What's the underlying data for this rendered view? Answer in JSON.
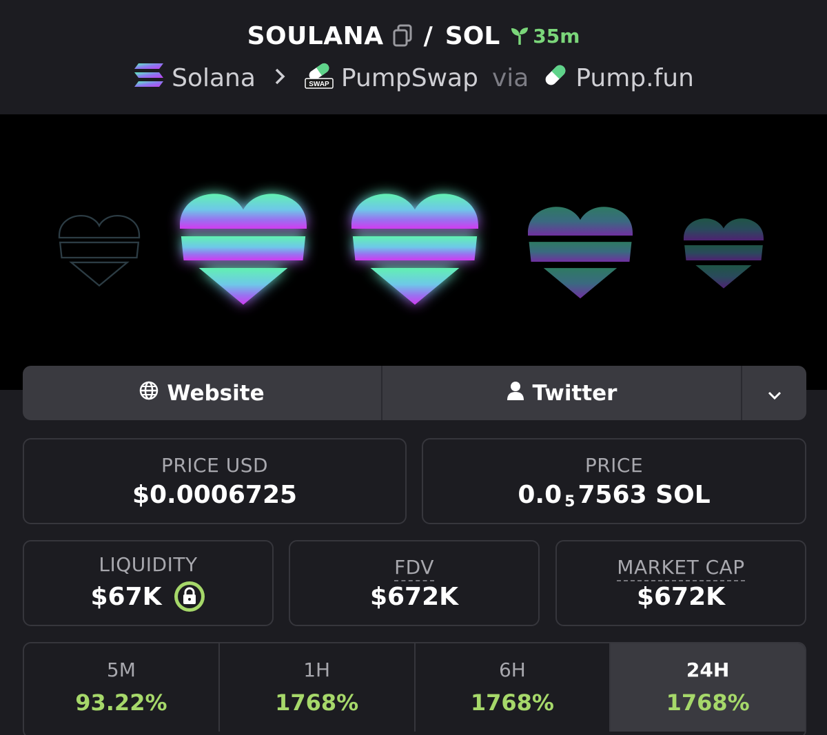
{
  "header": {
    "base_symbol": "SOULANA",
    "separator": "/",
    "quote_symbol": "SOL",
    "age": "35m",
    "chain": "Solana",
    "dex": "PumpSwap",
    "via_label": "via",
    "launchpad": "Pump.fun",
    "icons": {
      "copy": "copy-icon",
      "age": "sprout-icon",
      "chain": "solana-logo-icon",
      "dex": "pumpswap-logo-icon",
      "launchpad": "pill-icon"
    },
    "swap_badge": "SWAP"
  },
  "links": {
    "website_label": "Website",
    "twitter_label": "Twitter",
    "icons": {
      "website": "globe-icon",
      "twitter": "user-icon",
      "more": "chevron-down-icon"
    }
  },
  "stats": {
    "price_usd": {
      "label": "PRICE USD",
      "value": "$0.0006725"
    },
    "price": {
      "label": "PRICE",
      "value_prefix": "0.0",
      "zeros": "5",
      "value_suffix": "7563 SOL"
    },
    "liquidity": {
      "label": "LIQUIDITY",
      "value": "$67K",
      "icon": "lock-icon"
    },
    "fdv": {
      "label": "FDV",
      "value": "$672K"
    },
    "market_cap": {
      "label": "MARKET CAP",
      "value": "$672K"
    }
  },
  "periods": [
    {
      "label": "5M",
      "change": "93.22%",
      "active": false
    },
    {
      "label": "1H",
      "change": "1768%",
      "active": false
    },
    {
      "label": "6H",
      "change": "1768%",
      "active": false
    },
    {
      "label": "24H",
      "change": "1768%",
      "active": true
    }
  ],
  "colors": {
    "background": "#1c1c21",
    "panel": "#3a3a40",
    "positive": "#a6d86a",
    "age_green": "#7bd67a",
    "heart_top": "#5ef0b0",
    "heart_bottom": "#c040f0"
  }
}
